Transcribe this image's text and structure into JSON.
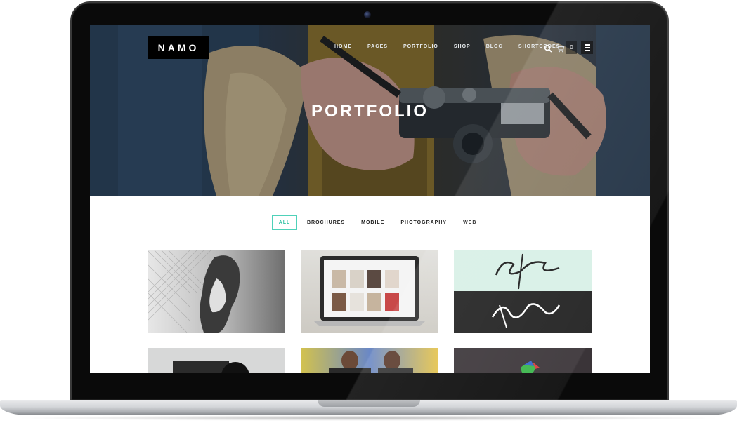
{
  "site": {
    "logo": "NAMO",
    "nav": [
      "HOME",
      "PAGES",
      "PORTFOLIO",
      "SHOP",
      "BLOG",
      "SHORTCODES"
    ],
    "cart_count": "0",
    "icons": [
      "search-icon",
      "cart-icon",
      "hamburger-menu-icon"
    ]
  },
  "hero": {
    "title": "PORTFOLIO"
  },
  "filters": {
    "items": [
      "ALL",
      "BROCHURES",
      "MOBILE",
      "PHOTOGRAPHY",
      "WEB"
    ],
    "active": "ALL"
  },
  "colors": {
    "accent": "#35c3a6",
    "logo_bg": "#000000",
    "text": "#222222"
  }
}
